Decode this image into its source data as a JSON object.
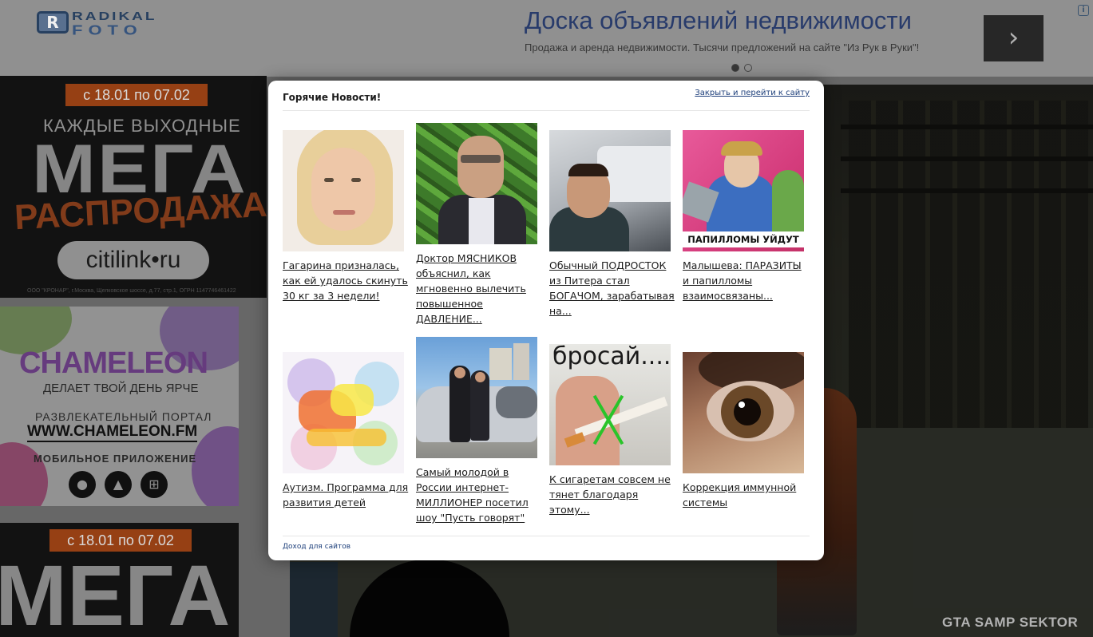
{
  "site_logo": {
    "badge": "R",
    "word1": "RADIKAL",
    "word2": "FOTO"
  },
  "top_ad": {
    "title": "Доска объявлений недвижимости",
    "text": "Продажа и аренда недвижимости. Тысячи предложений на сайте \"Из Рук в Руки\"!",
    "next_label": "›",
    "info_label": "i"
  },
  "left_ads": {
    "ad1": {
      "dates": "с 18.01 по 07.02",
      "weekends": "КАЖДЫЕ ВЫХОДНЫЕ",
      "mega": "МЕГА",
      "sale": "РАСПРОДАЖА",
      "store": "citilink•ru",
      "legal": "ООО \"КРОНАР\", г.Москва, Щелковское шоссе, д.77, стр.1, ОГРН 1147746461422"
    },
    "ad2": {
      "brand": "CHAMELEON",
      "tagline": "ДЕЛАЕТ ТВОЙ ДЕНЬ ЯРЧЕ",
      "portal": "РАЗВЛЕКАТЕЛЬНЫЙ ПОРТАЛ",
      "site": "WWW.CHAMELEON.FM",
      "mobile": "МОБИЛЬНОЕ ПРИЛОЖЕНИЕ",
      "os_icons": [
        "apple-icon",
        "android-icon",
        "windows-icon"
      ]
    },
    "ad3": {
      "dates": "с 18.01 по 07.02",
      "mega": "МЕГА"
    }
  },
  "watermark": "GTA SAMP SEKTOR",
  "modal": {
    "title": "Горячие Новости!",
    "close_link": "Закрыть и перейти к сайту",
    "footer_link": "Доход для сайтов",
    "news": [
      {
        "caption": "Гагарина призналась, как ей удалось скинуть 30 кг за 3 недели!",
        "image": "woman-portrait"
      },
      {
        "caption": "Доктор МЯСНИКОВ объяснил, как мгновенно вылечить повышенное ДАВЛЕНИЕ...",
        "image": "doctor-cucumbers"
      },
      {
        "caption": "Обычный ПОДРОСТОК из Питера стал БОГАЧОМ, зарабатывая на...",
        "image": "teen-car-selfie"
      },
      {
        "caption": "Малышева: ПАРАЗИТЫ и папилломы взаимосвязаны...",
        "image": "tv-show",
        "overlay": "ПАПИЛЛОМЫ УЙДУТ"
      },
      {
        "caption": "Аутизм. Программа для развития детей",
        "image": "autism-drawing"
      },
      {
        "caption": "Самый молодой в России интернет-МИЛЛИОНЕР посетил шоу \"Пусть говорят\"",
        "image": "couple-car"
      },
      {
        "caption": "К сигаретам совсем не тянет благодаря этому...",
        "image": "cigarette",
        "overlay": "бросай...."
      },
      {
        "caption": "Коррекция иммунной системы",
        "image": "eye-closeup"
      }
    ]
  }
}
